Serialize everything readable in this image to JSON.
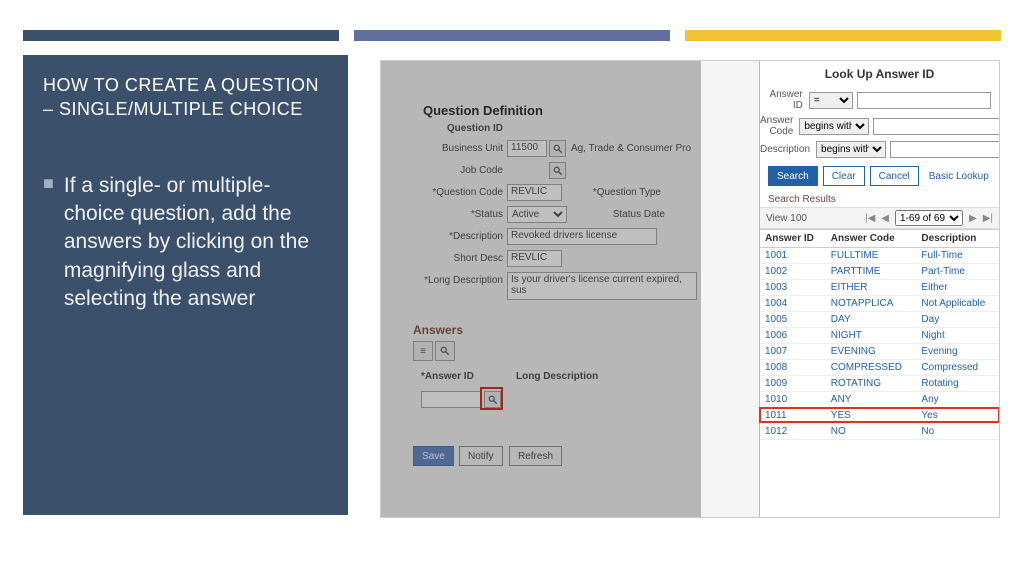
{
  "slide": {
    "title": "HOW TO CREATE A QUESTION – SINGLE/MULTIPLE CHOICE",
    "bullet": "If a single- or multiple-choice question, add the answers by clicking on the magnifying glass and selecting the answer"
  },
  "qd": {
    "section_title": "Question Definition",
    "labels": {
      "question_id": "Question ID",
      "business_unit": "Business Unit",
      "job_code": "Job Code",
      "question_code": "*Question Code",
      "question_type": "*Question Type",
      "status": "*Status",
      "status_date": "Status Date",
      "description": "*Description",
      "short_desc": "Short Desc",
      "long_desc": "*Long Description",
      "answers": "Answers",
      "answer_id": "*Answer ID",
      "long_desc_col": "Long Description"
    },
    "values": {
      "business_unit": "11500",
      "business_unit_name": "Ag, Trade & Consumer Pro",
      "question_code": "REVLIC",
      "status": "Active",
      "description": "Revoked drivers license",
      "short_desc": "REVLIC",
      "long_description": "Is your driver's license current expired, sus"
    },
    "buttons": {
      "save": "Save",
      "notify": "Notify",
      "refresh": "Refresh"
    }
  },
  "lookup": {
    "title": "Look Up Answer ID",
    "fields": {
      "answer_id": "Answer ID",
      "answer_code": "Answer Code",
      "description": "Description"
    },
    "ops": {
      "equals": "=",
      "begins": "begins with"
    },
    "buttons": {
      "search": "Search",
      "clear": "Clear",
      "cancel": "Cancel",
      "basic": "Basic Lookup"
    },
    "sr_label": "Search Results",
    "pager": {
      "view": "View 100",
      "range": "1-69 of 69"
    },
    "columns": {
      "id": "Answer ID",
      "code": "Answer Code",
      "desc": "Description"
    },
    "rows": [
      {
        "id": "1001",
        "code": "FULLTIME",
        "desc": "Full-Time"
      },
      {
        "id": "1002",
        "code": "PARTTIME",
        "desc": "Part-Time"
      },
      {
        "id": "1003",
        "code": "EITHER",
        "desc": "Either"
      },
      {
        "id": "1004",
        "code": "NOTAPPLICA",
        "desc": "Not Applicable"
      },
      {
        "id": "1005",
        "code": "DAY",
        "desc": "Day"
      },
      {
        "id": "1006",
        "code": "NIGHT",
        "desc": "Night"
      },
      {
        "id": "1007",
        "code": "EVENING",
        "desc": "Evening"
      },
      {
        "id": "1008",
        "code": "COMPRESSED",
        "desc": "Compressed"
      },
      {
        "id": "1009",
        "code": "ROTATING",
        "desc": "Rotating"
      },
      {
        "id": "1010",
        "code": "ANY",
        "desc": "Any"
      },
      {
        "id": "1011",
        "code": "YES",
        "desc": "Yes"
      },
      {
        "id": "1012",
        "code": "NO",
        "desc": "No"
      }
    ],
    "highlight_row_index": 10
  }
}
